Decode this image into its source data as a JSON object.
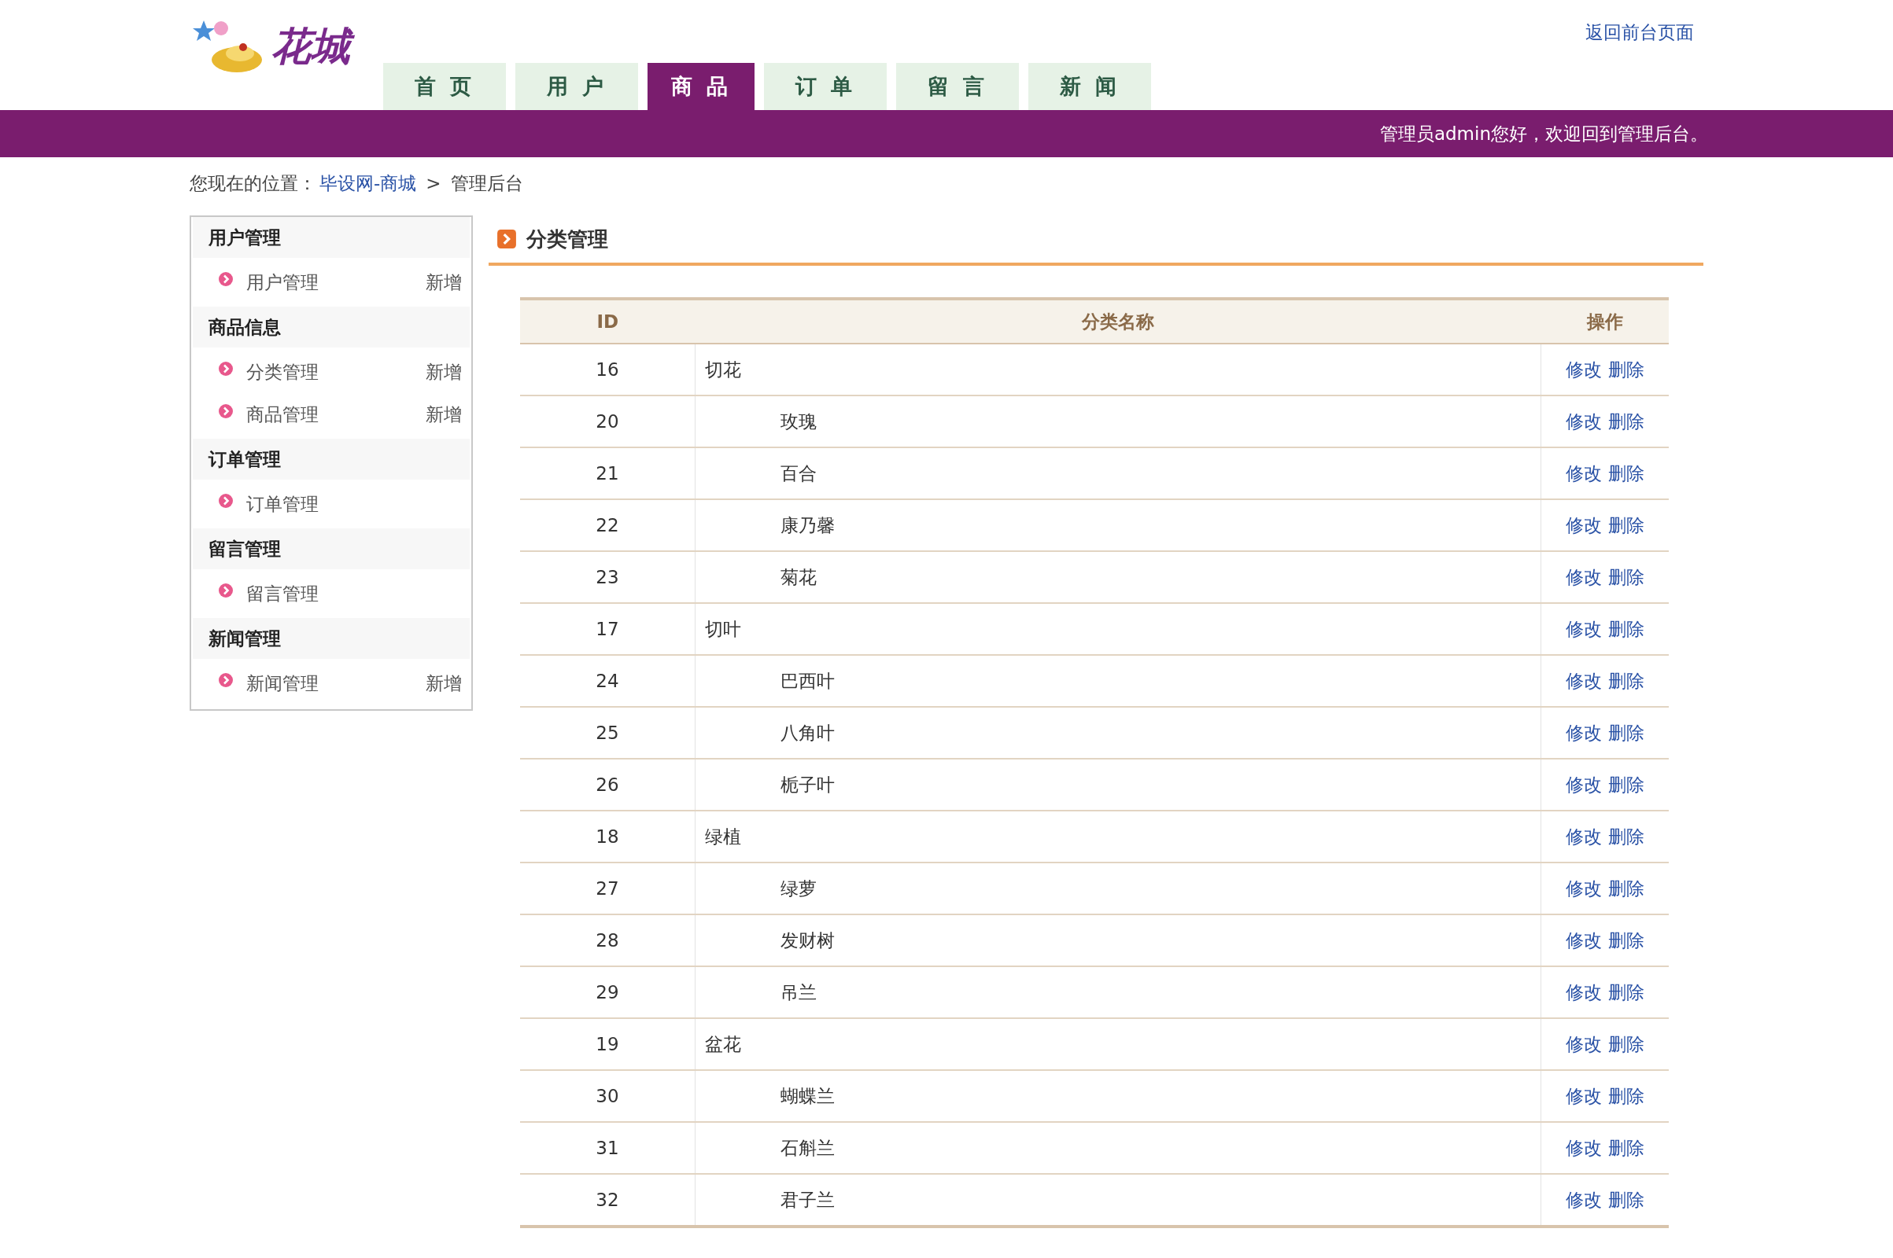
{
  "header": {
    "logo_text": "花城",
    "top_link": "返回前台页面"
  },
  "nav_tabs": [
    {
      "label": "首 页",
      "selected": false
    },
    {
      "label": "用 户",
      "selected": false
    },
    {
      "label": "商 品",
      "selected": true
    },
    {
      "label": "订 单",
      "selected": false
    },
    {
      "label": "留 言",
      "selected": false
    },
    {
      "label": "新 闻",
      "selected": false
    }
  ],
  "banner": {
    "greeting": "管理员admin您好，欢迎回到管理后台。"
  },
  "breadcrumb": {
    "prefix": "您现在的位置：",
    "link": "毕设网-商城",
    "separator": ">",
    "current": "管理后台"
  },
  "sidebar": {
    "groups": [
      {
        "title": "用户管理",
        "items": [
          {
            "label": "用户管理",
            "action": "新增"
          }
        ]
      },
      {
        "title": "商品信息",
        "items": [
          {
            "label": "分类管理",
            "action": "新增"
          },
          {
            "label": "商品管理",
            "action": "新增"
          }
        ]
      },
      {
        "title": "订单管理",
        "items": [
          {
            "label": "订单管理"
          }
        ]
      },
      {
        "title": "留言管理",
        "items": [
          {
            "label": "留言管理"
          }
        ]
      },
      {
        "title": "新闻管理",
        "items": [
          {
            "label": "新闻管理",
            "action": "新增"
          }
        ]
      }
    ]
  },
  "main": {
    "title": "分类管理",
    "table": {
      "columns": [
        "ID",
        "分类名称",
        "操作"
      ],
      "rows": [
        {
          "id": "16",
          "name": "切花",
          "actions": [
            "修改",
            "删除"
          ],
          "children": [
            {
              "id": "20",
              "name": "玫瑰",
              "actions": [
                "修改",
                "删除"
              ]
            },
            {
              "id": "21",
              "name": "百合",
              "actions": [
                "修改",
                "删除"
              ]
            },
            {
              "id": "22",
              "name": "康乃馨",
              "actions": [
                "修改",
                "删除"
              ]
            },
            {
              "id": "23",
              "name": "菊花",
              "actions": [
                "修改",
                "删除"
              ]
            }
          ]
        },
        {
          "id": "17",
          "name": "切叶",
          "actions": [
            "修改",
            "删除"
          ],
          "children": [
            {
              "id": "24",
              "name": "巴西叶",
              "actions": [
                "修改",
                "删除"
              ]
            },
            {
              "id": "25",
              "name": "八角叶",
              "actions": [
                "修改",
                "删除"
              ]
            },
            {
              "id": "26",
              "name": "栀子叶",
              "actions": [
                "修改",
                "删除"
              ]
            }
          ]
        },
        {
          "id": "18",
          "name": "绿植",
          "actions": [
            "修改",
            "删除"
          ],
          "children": [
            {
              "id": "27",
              "name": "绿萝",
              "actions": [
                "修改",
                "删除"
              ]
            },
            {
              "id": "28",
              "name": "发财树",
              "actions": [
                "修改",
                "删除"
              ]
            },
            {
              "id": "29",
              "name": "吊兰",
              "actions": [
                "修改",
                "删除"
              ]
            }
          ]
        },
        {
          "id": "19",
          "name": "盆花",
          "actions": [
            "修改",
            "删除"
          ],
          "children": [
            {
              "id": "30",
              "name": "蝴蝶兰",
              "actions": [
                "修改",
                "删除"
              ]
            },
            {
              "id": "31",
              "name": "石斛兰",
              "actions": [
                "修改",
                "删除"
              ]
            },
            {
              "id": "32",
              "name": "君子兰",
              "actions": [
                "修改",
                "删除"
              ]
            }
          ]
        }
      ]
    }
  }
}
